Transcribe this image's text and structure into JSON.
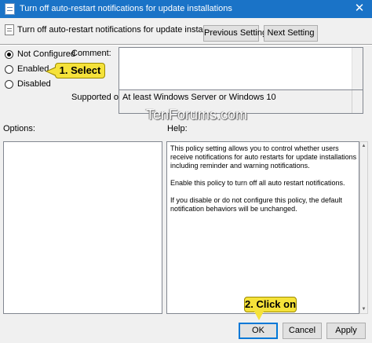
{
  "window": {
    "title": "Turn off auto-restart notifications for update installations",
    "close_glyph": "✕",
    "titlebar_color": "#1a73c7"
  },
  "header": {
    "policy_title": "Turn off auto-restart notifications for update installations",
    "previous_label": "Previous Setting",
    "next_label": "Next Setting"
  },
  "state": {
    "options": [
      {
        "label": "Not Configured",
        "checked": true
      },
      {
        "label": "Enabled",
        "checked": false
      },
      {
        "label": "Disabled",
        "checked": false
      }
    ]
  },
  "comment": {
    "label": "Comment:",
    "value": ""
  },
  "supported": {
    "label": "Supported on:",
    "value": "At least Windows Server or Windows 10"
  },
  "watermark": "TenForums.com",
  "options_panel": {
    "label": "Options:"
  },
  "help_panel": {
    "label": "Help:",
    "paragraphs": [
      "This policy setting allows you to control whether users receive notifications for auto restarts for update installations including reminder and warning notifications.",
      "Enable this policy to turn off all auto restart notifications.",
      "If you disable or do not configure this policy, the default notification behaviors will be unchanged."
    ]
  },
  "callouts": {
    "select": "1. Select",
    "click": "2. Click on"
  },
  "footer": {
    "ok": "OK",
    "cancel": "Cancel",
    "apply": "Apply"
  }
}
